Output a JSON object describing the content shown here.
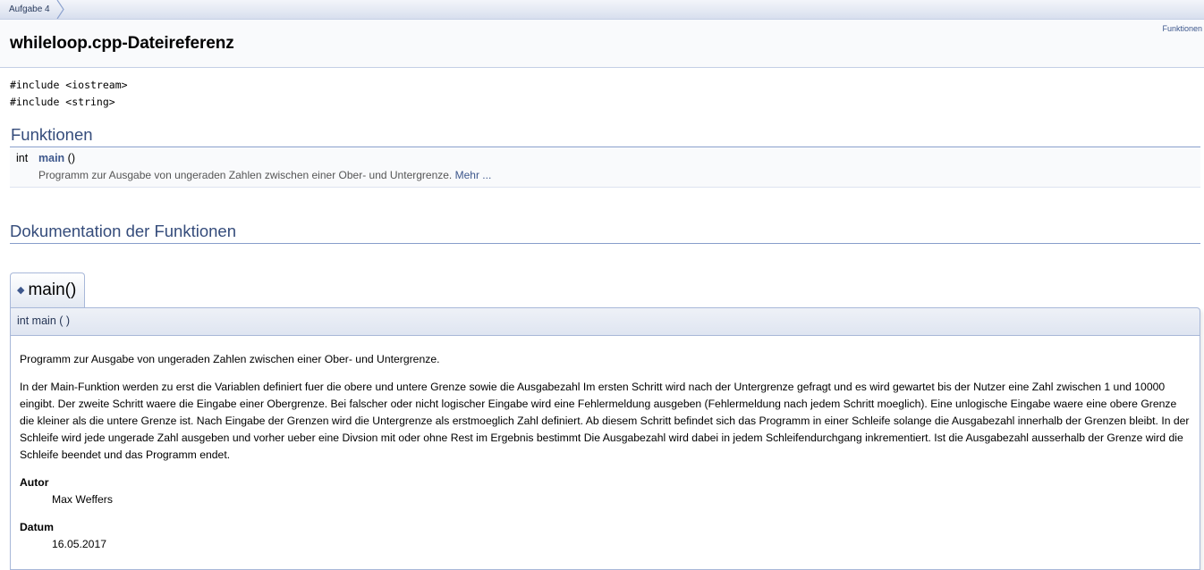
{
  "navpath": {
    "item": "Aufgabe 4"
  },
  "header": {
    "summary_link": "Funktionen",
    "title": "whileloop.cpp-Dateireferenz"
  },
  "includes": [
    "#include <iostream>",
    "#include <string>"
  ],
  "functions_section": {
    "heading": "Funktionen",
    "members": [
      {
        "type": "int",
        "name": "main",
        "args": " ()",
        "brief": "Programm zur Ausgabe von ungeraden Zahlen zwischen einer Ober- und Untergrenze.",
        "more": "Mehr ..."
      }
    ]
  },
  "doc_section": {
    "heading": "Dokumentation der Funktionen",
    "member": {
      "permalink_symbol": "◆",
      "title": "main()",
      "prototype": "int main ( )",
      "brief": "Programm zur Ausgabe von ungeraden Zahlen zwischen einer Ober- und Untergrenze.",
      "details": "In der Main-Funktion werden zu erst die Variablen definiert fuer die obere und untere Grenze sowie die Ausgabezahl Im ersten Schritt wird nach der Untergrenze gefragt und es wird gewartet bis der Nutzer eine Zahl zwischen 1 und 10000 eingibt. Der zweite Schritt waere die Eingabe einer Obergrenze. Bei falscher oder nicht logischer Eingabe wird eine Fehlermeldung ausgeben (Fehlermeldung nach jedem Schritt moeglich). Eine unlogische Eingabe waere eine obere Grenze die kleiner als die untere Grenze ist. Nach Eingabe der Grenzen wird die Untergrenze als erstmoeglich Zahl definiert. Ab diesem Schritt befindet sich das Programm in einer Schleife solange die Ausgabezahl innerhalb der Grenzen bleibt. In der Schleife wird jede ungerade Zahl ausgeben und vorher ueber eine Divsion mit oder ohne Rest im Ergebnis bestimmt Die Ausgabezahl wird dabei in jedem Schleifendurchgang inkrementiert. Ist die Ausgabezahl ausserhalb der Grenze wird die Schleife beendet und das Programm endet.",
      "author_label": "Autor",
      "author": "Max Weffers",
      "date_label": "Datum",
      "date": "16.05.2017"
    }
  },
  "colors": {
    "link": "#3d578c",
    "heading": "#354c7b",
    "border": "#a8b8d9"
  }
}
